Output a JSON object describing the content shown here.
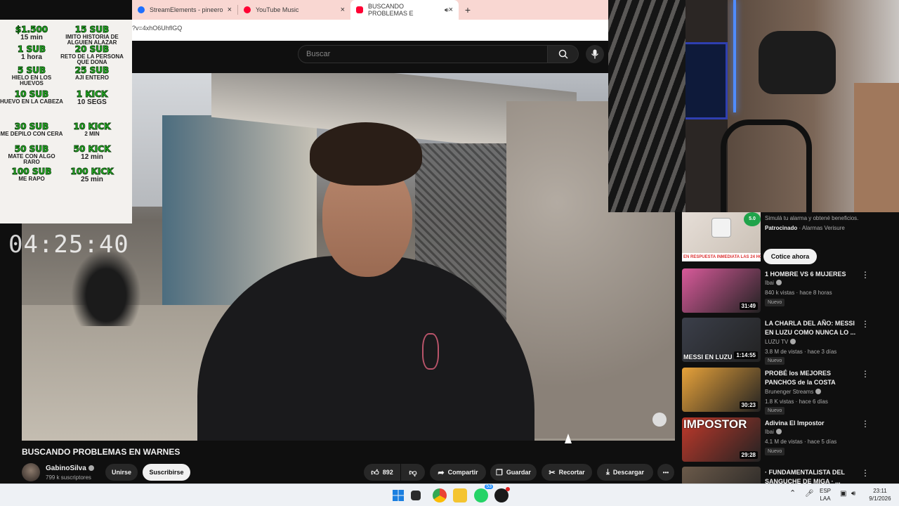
{
  "browser": {
    "tabs": [
      {
        "label": "StreamElements - pineero",
        "color": "#1e6fff"
      },
      {
        "label": "YouTube Music",
        "color": "#ff0033"
      },
      {
        "label": "BUSCANDO PROBLEMAS E",
        "color": "#ff0033"
      }
    ],
    "close_glyph": "×",
    "new_tab_glyph": "+",
    "url": "?v=4xhO6UhflGQ"
  },
  "youtube": {
    "search_placeholder": "Buscar",
    "video_title": "BUSCANDO PROBLEMAS EN WARNES",
    "channel": {
      "name": "GabinoSilva",
      "subscribers": "799 k suscriptores"
    },
    "join_label": "Unirse",
    "subscribe_label": "Suscribirse",
    "actions": {
      "likes": "892",
      "share": "Compartir",
      "save": "Guardar",
      "clip": "Recortar",
      "download": "Descargar",
      "more": "•••"
    }
  },
  "overlay": {
    "clock": "04:25:40",
    "rewards_left": [
      {
        "title": "$1.500",
        "desc": "15 min"
      },
      {
        "title": "1 SUB",
        "desc": "1 hora"
      },
      {
        "title": "5 SUB",
        "desc": "HIELO EN LOS HUEVOS"
      },
      {
        "title": "10 SUB",
        "desc": "HUEVO EN LA CABEZA"
      },
      {
        "title": "30 SUB",
        "desc": "ME DEPILO CON CERA"
      },
      {
        "title": "50 SUB",
        "desc": "MATE CON ALGO RARO"
      },
      {
        "title": "100 SUB",
        "desc": "ME RAPO"
      }
    ],
    "rewards_right": [
      {
        "title": "15 SUB",
        "desc": "IMITO HISTORIA DE ALGUIEN ALAZAR"
      },
      {
        "title": "20 SUB",
        "desc": "RETO DE LA PERSONA QUE DONA"
      },
      {
        "title": "25 SUB",
        "desc": "AJI ENTERO"
      },
      {
        "title": "1 KICK",
        "desc": "10 SEGS"
      },
      {
        "title": "10 KICK",
        "desc": "2 MIN"
      },
      {
        "title": "50 KICK",
        "desc": "12 min"
      },
      {
        "title": "100 KICK",
        "desc": "25 min"
      }
    ]
  },
  "ad": {
    "text": "Simulá tu alarma y obtené beneficios.",
    "sponsor_label": "Patrocinado",
    "sponsor": "Alarmas Verisure",
    "strip": "EN RESPUESTA INMEDIATA LAS 24 HORA",
    "badge": "5.0",
    "cta": "Cotice ahora"
  },
  "recommendations": [
    {
      "title": "1 HOMBRE VS 6 MUJERES",
      "channel": "Ibai",
      "stats": "840 k vistas · hace 8 horas",
      "badge": "Nuevo",
      "duration": "31:49",
      "thumb": "#d85a9a"
    },
    {
      "title": "LA CHARLA DEL AÑO: MESSI EN LUZU COMO NUNCA LO ...",
      "channel": "LUZU TV",
      "stats": "3.8 M de vistas · hace 3 días",
      "badge": "Nuevo",
      "duration": "1:14:55",
      "thumb_text": "MESSI EN LUZU",
      "thumb": "#3b3f4a"
    },
    {
      "title": "PROBÉ los MEJORES PANCHOS de la COSTA ARGENTINA",
      "channel": "Brunenger Streams",
      "stats": "1.8 K vistas · hace 6 días",
      "badge": "Nuevo",
      "duration": "30:23",
      "thumb": "#e7a23a"
    },
    {
      "title": "Adivina El Impostor",
      "channel": "Ibai",
      "stats": "4.1 M de vistas · hace 5 días",
      "badge": "Nuevo",
      "duration": "29:28",
      "thumb_text": "IMPOSTOR",
      "thumb": "#c0392b"
    },
    {
      "title": "· FUNDAMENTALISTA DEL SANGUCHE DE MIGA · ...",
      "channel": "",
      "stats": "",
      "badge": "",
      "duration": "",
      "thumb": "#6b5a4a"
    }
  ],
  "taskbar": {
    "lang_top": "ESP",
    "lang_bottom": "LAA",
    "time": "23:11",
    "date": "9/1/2026",
    "whatsapp_badge": "53",
    "chevron": "⌃"
  }
}
